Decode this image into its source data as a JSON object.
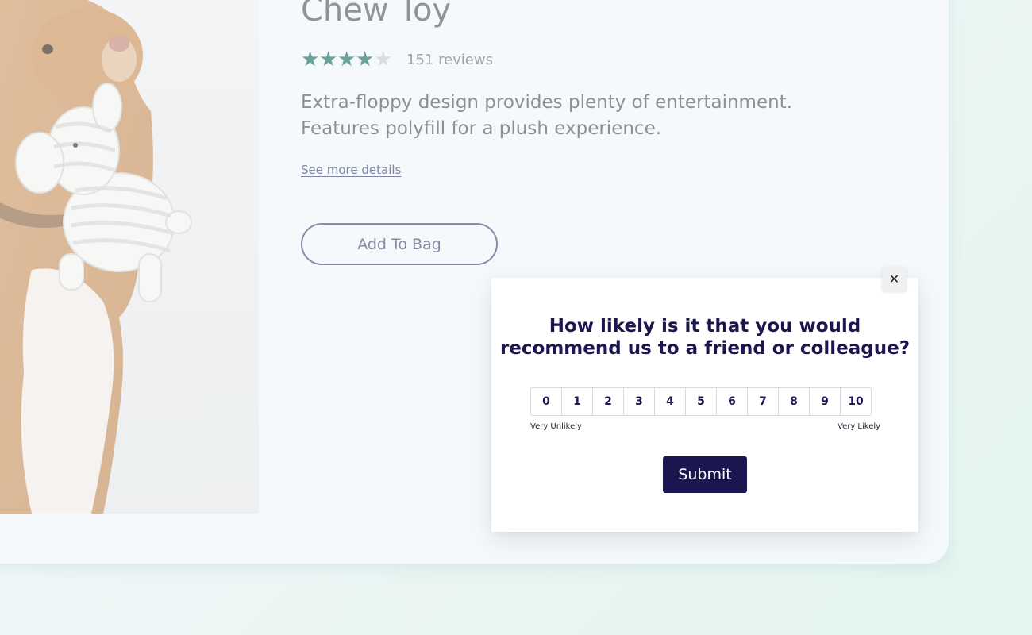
{
  "product": {
    "title": "Chew Toy",
    "rating": 4,
    "rating_max": 5,
    "reviews_label": "151 reviews",
    "description": "Extra-floppy design provides plenty of entertainment. Features polyfill for a plush experience.",
    "see_more_label": "See more details",
    "add_to_bag_label": "Add To Bag"
  },
  "survey": {
    "close_label": "✕",
    "question": "How likely is it that you would recommend us to a friend or colleague?",
    "scale": [
      "0",
      "1",
      "2",
      "3",
      "4",
      "5",
      "6",
      "7",
      "8",
      "9",
      "10"
    ],
    "low_label": "Very Unlikely",
    "high_label": "Very Likely",
    "submit_label": "Submit"
  },
  "colors": {
    "accent_navy": "#1b1650",
    "star_on": "#6aa39c",
    "star_off": "#d9dde0"
  },
  "icons": {
    "close": "close-icon",
    "star": "star-icon"
  }
}
